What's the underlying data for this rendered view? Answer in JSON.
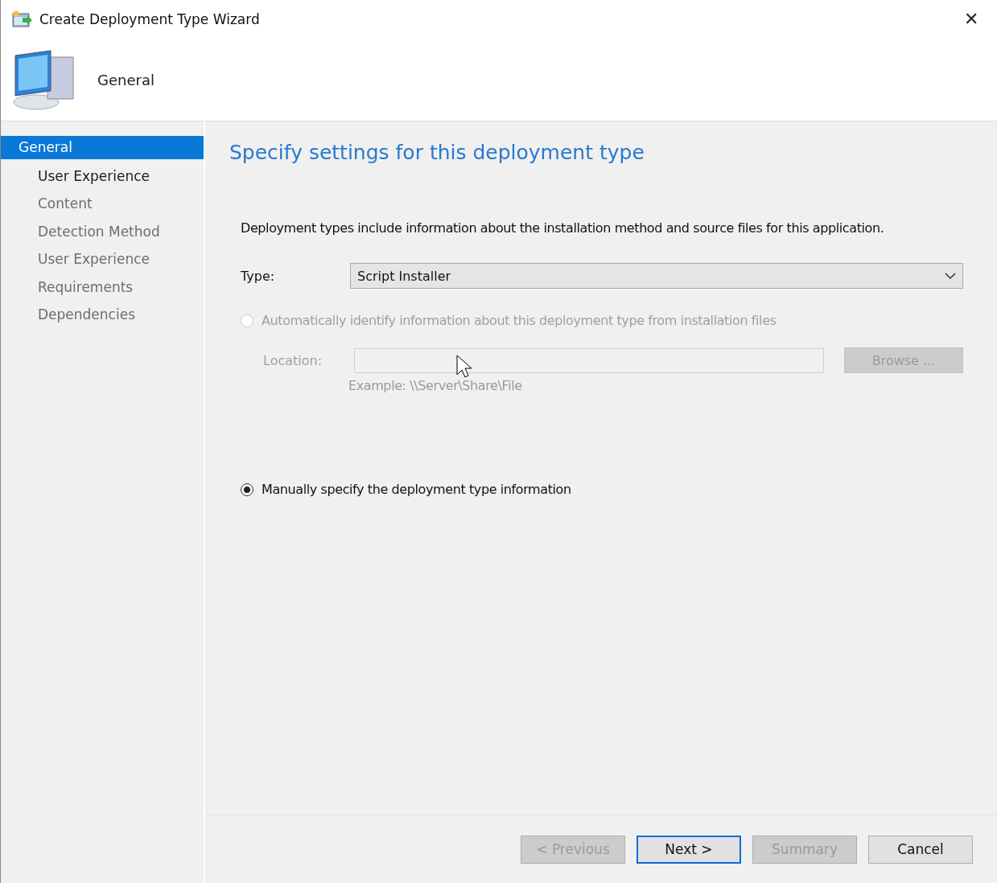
{
  "window": {
    "title": "Create Deployment Type Wizard",
    "close": "✕"
  },
  "header": {
    "title": "General"
  },
  "sidebar": {
    "items": [
      {
        "label": "General",
        "selected": true,
        "disabled": false
      },
      {
        "label": "User Experience",
        "selected": false,
        "disabled": false
      },
      {
        "label": "Content",
        "selected": false,
        "disabled": true
      },
      {
        "label": "Detection Method",
        "selected": false,
        "disabled": true
      },
      {
        "label": "User Experience",
        "selected": false,
        "disabled": true
      },
      {
        "label": "Requirements",
        "selected": false,
        "disabled": true
      },
      {
        "label": "Dependencies",
        "selected": false,
        "disabled": true
      }
    ]
  },
  "page": {
    "heading": "Specify settings for this deployment type",
    "description": "Deployment types include information about the installation method and source files for this application.",
    "type_label": "Type:",
    "type_value": "Script Installer",
    "options": [
      {
        "label": "Automatically identify information about this deployment type from installation files",
        "selected": false,
        "disabled": true
      },
      {
        "label": "Manually specify the deployment type information",
        "selected": true,
        "disabled": false
      }
    ],
    "location_label": "Location:",
    "location_example": "Example: \\\\Server\\Share\\File",
    "browse": "Browse ..."
  },
  "buttons": [
    {
      "label": "< Previous",
      "disabled": true,
      "default": false
    },
    {
      "label": "Next >",
      "disabled": false,
      "default": true
    },
    {
      "label": "Summary",
      "disabled": true,
      "default": false
    },
    {
      "label": "Cancel",
      "disabled": false,
      "default": false
    }
  ]
}
